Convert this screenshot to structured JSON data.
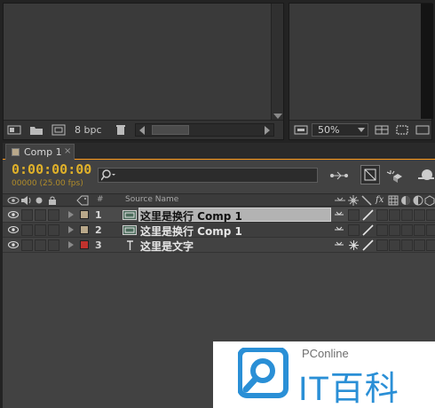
{
  "project_panel": {
    "bpc_label": "8 bpc"
  },
  "viewer": {
    "zoom": "50%"
  },
  "timeline": {
    "tab_label": "Comp 1",
    "tab_close": "×",
    "timecode": "0:00:00:00",
    "frame_info": "00000 (25.00 fps)",
    "columns": {
      "hash": "#",
      "source_name": "Source Name"
    },
    "layers": [
      {
        "number": "1",
        "name": "这里是换行 Comp 1",
        "label_color": "#b9a88a",
        "type": "comp-icon",
        "selected": true
      },
      {
        "number": "2",
        "name": "这里是换行 Comp 1",
        "label_color": "#b9a88a",
        "type": "comp-icon",
        "selected": false
      },
      {
        "number": "3",
        "name": "这里是文字",
        "label_color": "#c0322d",
        "type": "text-icon",
        "selected": false
      }
    ]
  },
  "watermark": {
    "brand": "PConline",
    "text": "IT百科"
  }
}
